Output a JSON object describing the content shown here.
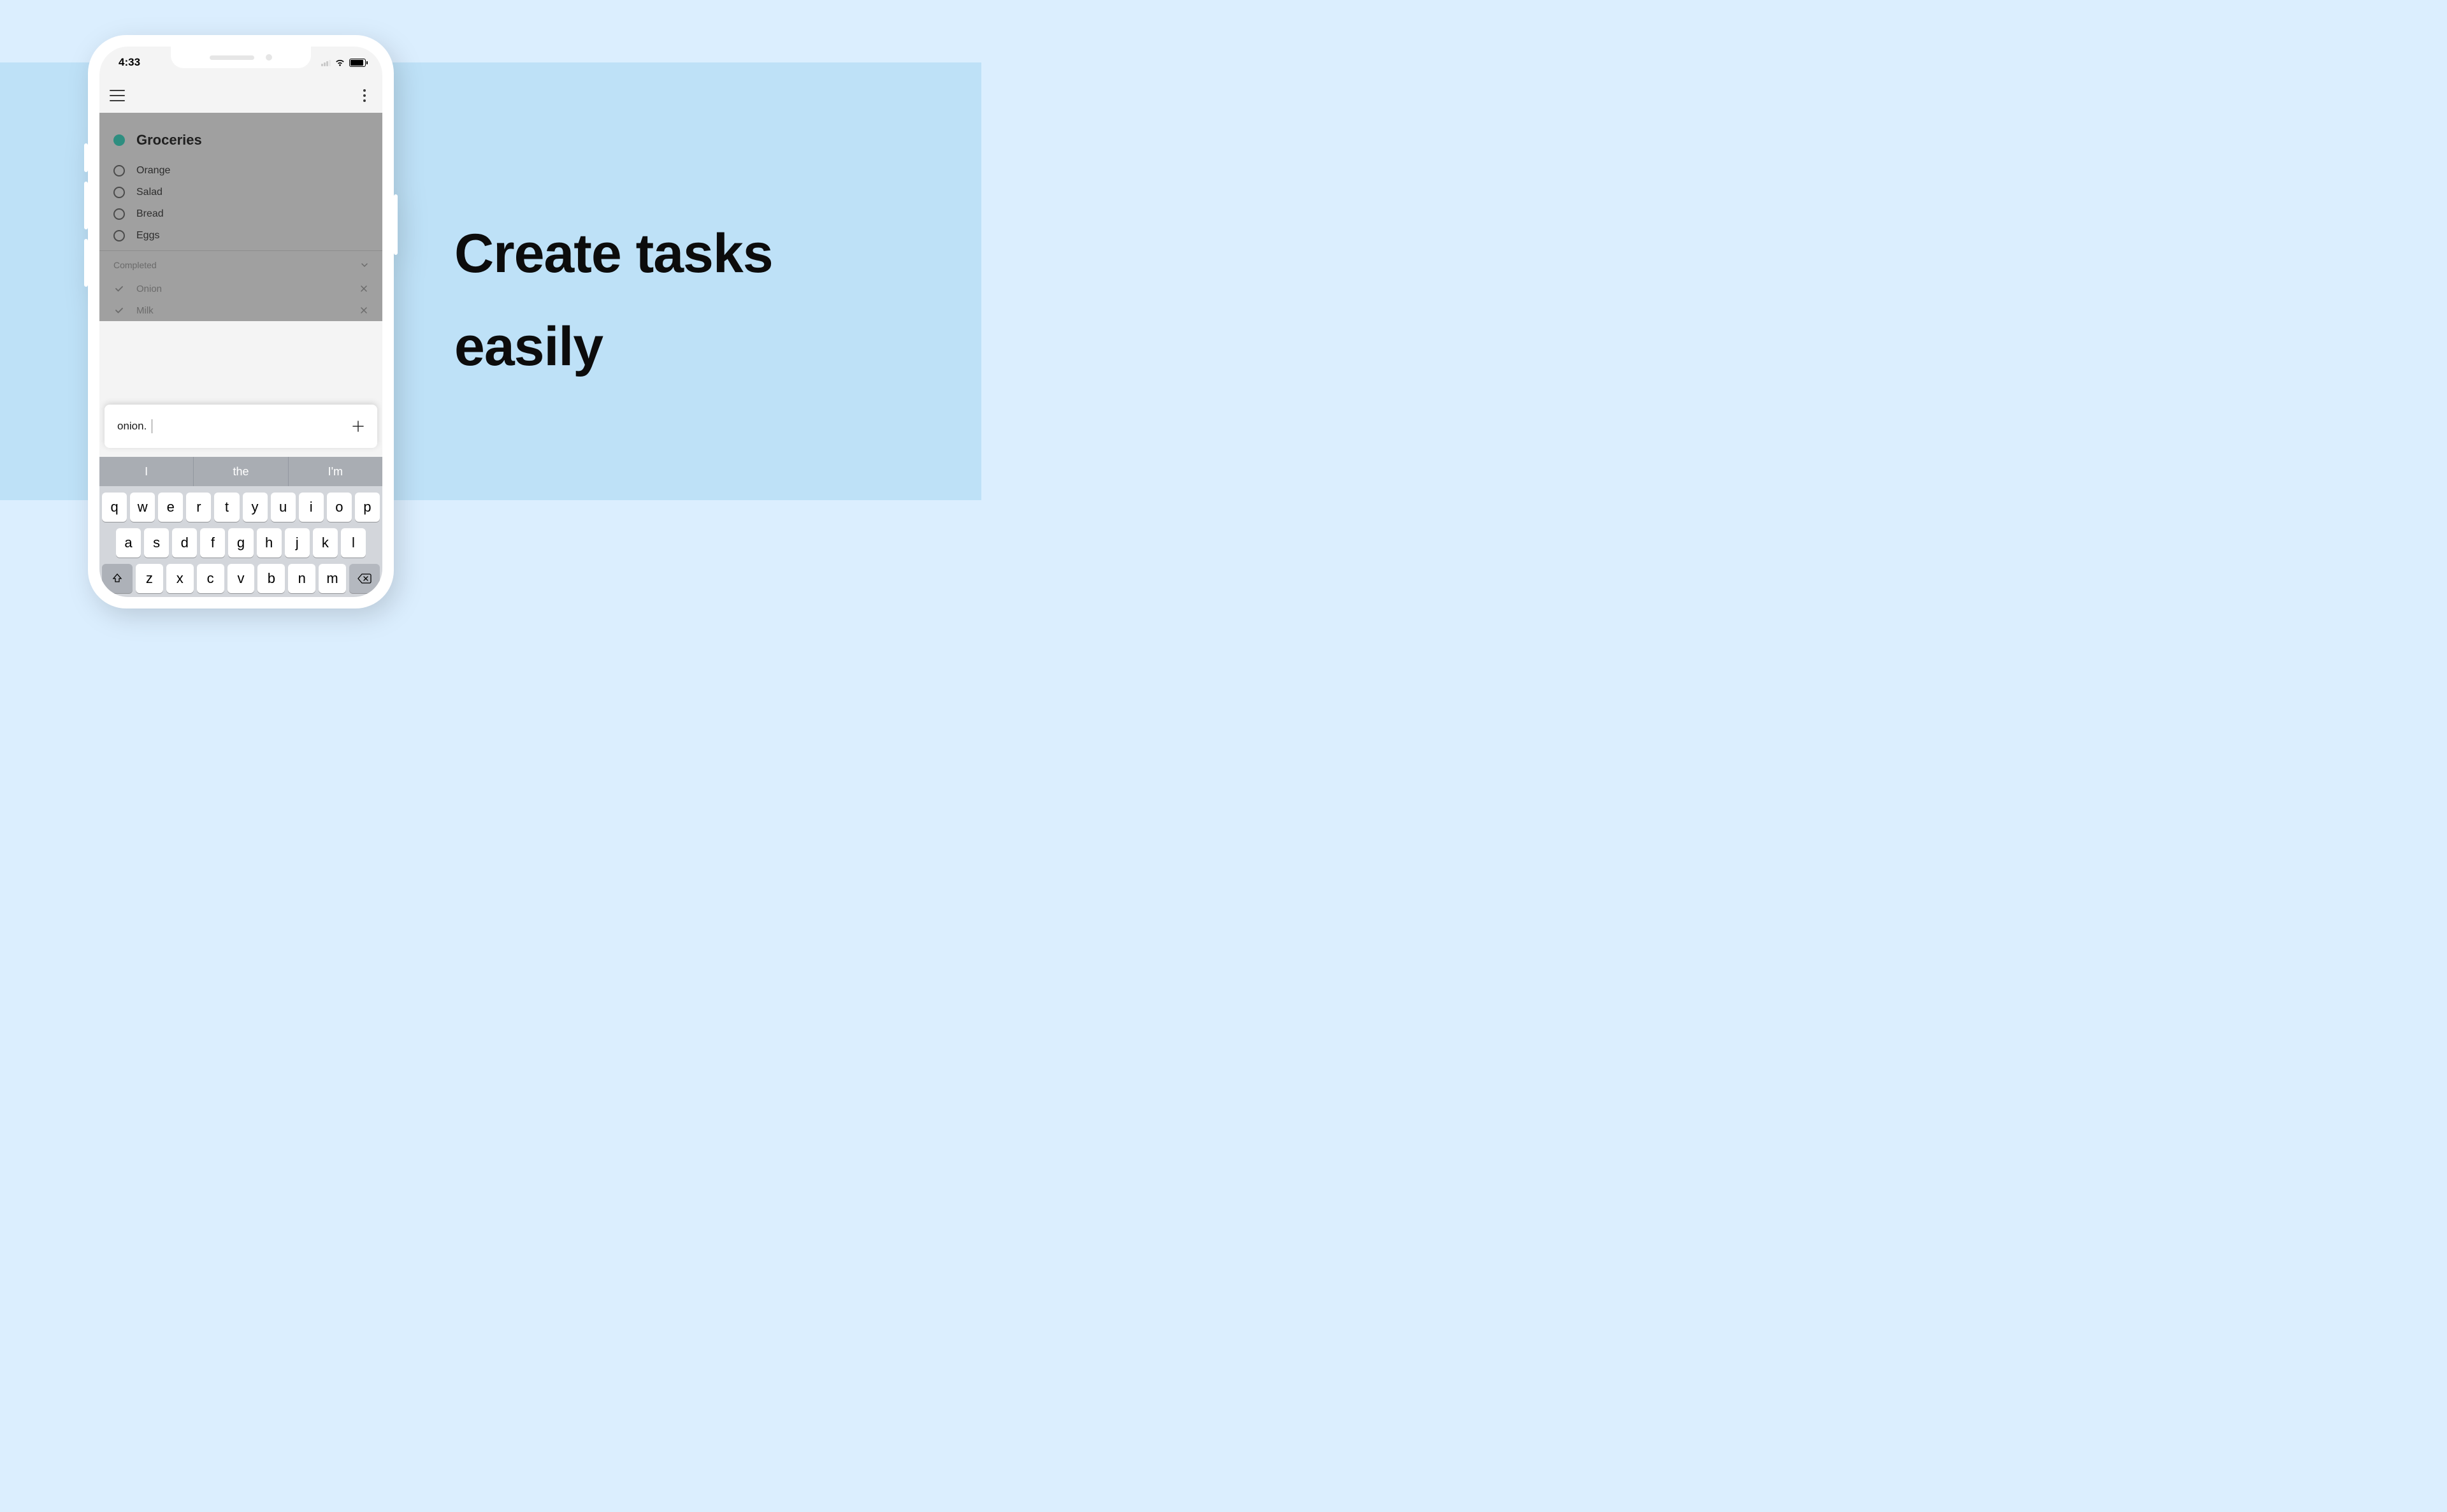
{
  "hero": {
    "line1": "Create tasks",
    "line2": "easily"
  },
  "status": {
    "time": "4:33"
  },
  "list": {
    "title": "Groceries",
    "tasks": [
      {
        "label": "Orange"
      },
      {
        "label": "Salad"
      },
      {
        "label": "Bread"
      },
      {
        "label": "Eggs"
      }
    ],
    "completed_section": "Completed",
    "completed": [
      {
        "label": "Onion"
      },
      {
        "label": "Milk"
      }
    ]
  },
  "input": {
    "value": "onion."
  },
  "keyboard": {
    "suggestions": [
      "I",
      "the",
      "I'm"
    ],
    "row1": [
      "q",
      "w",
      "e",
      "r",
      "t",
      "y",
      "u",
      "i",
      "o",
      "p"
    ],
    "row2": [
      "a",
      "s",
      "d",
      "f",
      "g",
      "h",
      "j",
      "k",
      "l"
    ],
    "row3": [
      "z",
      "x",
      "c",
      "v",
      "b",
      "n",
      "m"
    ]
  }
}
